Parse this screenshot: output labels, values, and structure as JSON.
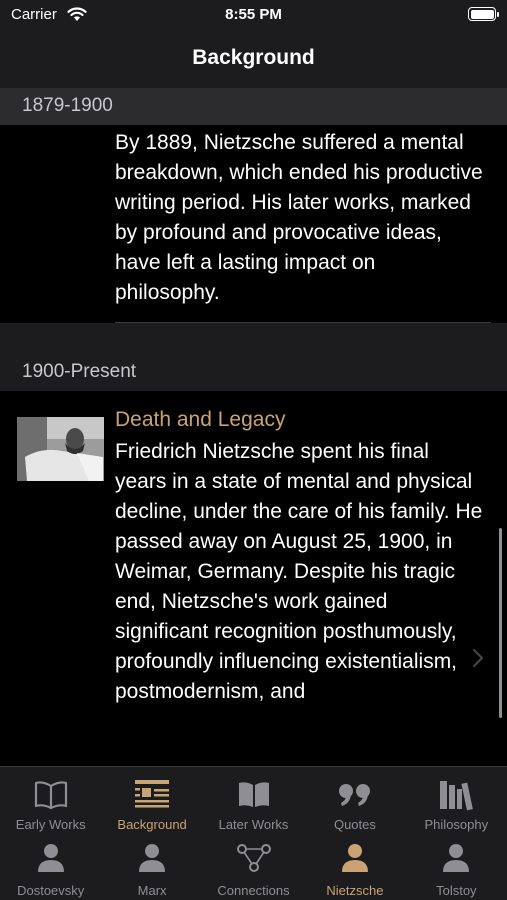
{
  "status_bar": {
    "carrier": "Carrier",
    "time": "8:55 PM"
  },
  "nav": {
    "title": "Background"
  },
  "sections": [
    {
      "header": "1879-1900",
      "items": [
        {
          "text": "By 1889, Nietzsche suffered a mental breakdown, which ended his productive writing period. His later works, marked by profound and provocative ideas, have left a lasting impact on philosophy."
        }
      ]
    },
    {
      "header": "1900-Present",
      "items": [
        {
          "title": "Death and Legacy",
          "text": "Friedrich Nietzsche spent his final years in a state of mental and physical decline, under the care of his family. He passed away on August 25, 1900, in Weimar, Germany. Despite his tragic end, Nietzsche's work gained significant recognition posthumously, profoundly influencing existentialism, postmodernism, and"
        }
      ]
    }
  ],
  "tabs_row1": [
    {
      "label": "Early Works",
      "icon": "open-book-icon",
      "active": false
    },
    {
      "label": "Background",
      "icon": "list-icon",
      "active": true
    },
    {
      "label": "Later Works",
      "icon": "book-filled-icon",
      "active": false
    },
    {
      "label": "Quotes",
      "icon": "quote-icon",
      "active": false
    },
    {
      "label": "Philosophy",
      "icon": "books-icon",
      "active": false
    }
  ],
  "tabs_row2": [
    {
      "label": "Dostoevsky",
      "icon": "person-icon",
      "active": false
    },
    {
      "label": "Marx",
      "icon": "person-icon",
      "active": false
    },
    {
      "label": "Connections",
      "icon": "network-icon",
      "active": false
    },
    {
      "label": "Nietzsche",
      "icon": "person-icon",
      "active": true
    },
    {
      "label": "Tolstoy",
      "icon": "person-icon",
      "active": false
    }
  ],
  "colors": {
    "accent": "#c9a374",
    "inactive": "#8e8e93",
    "bar_bg": "#1c1c1e"
  }
}
